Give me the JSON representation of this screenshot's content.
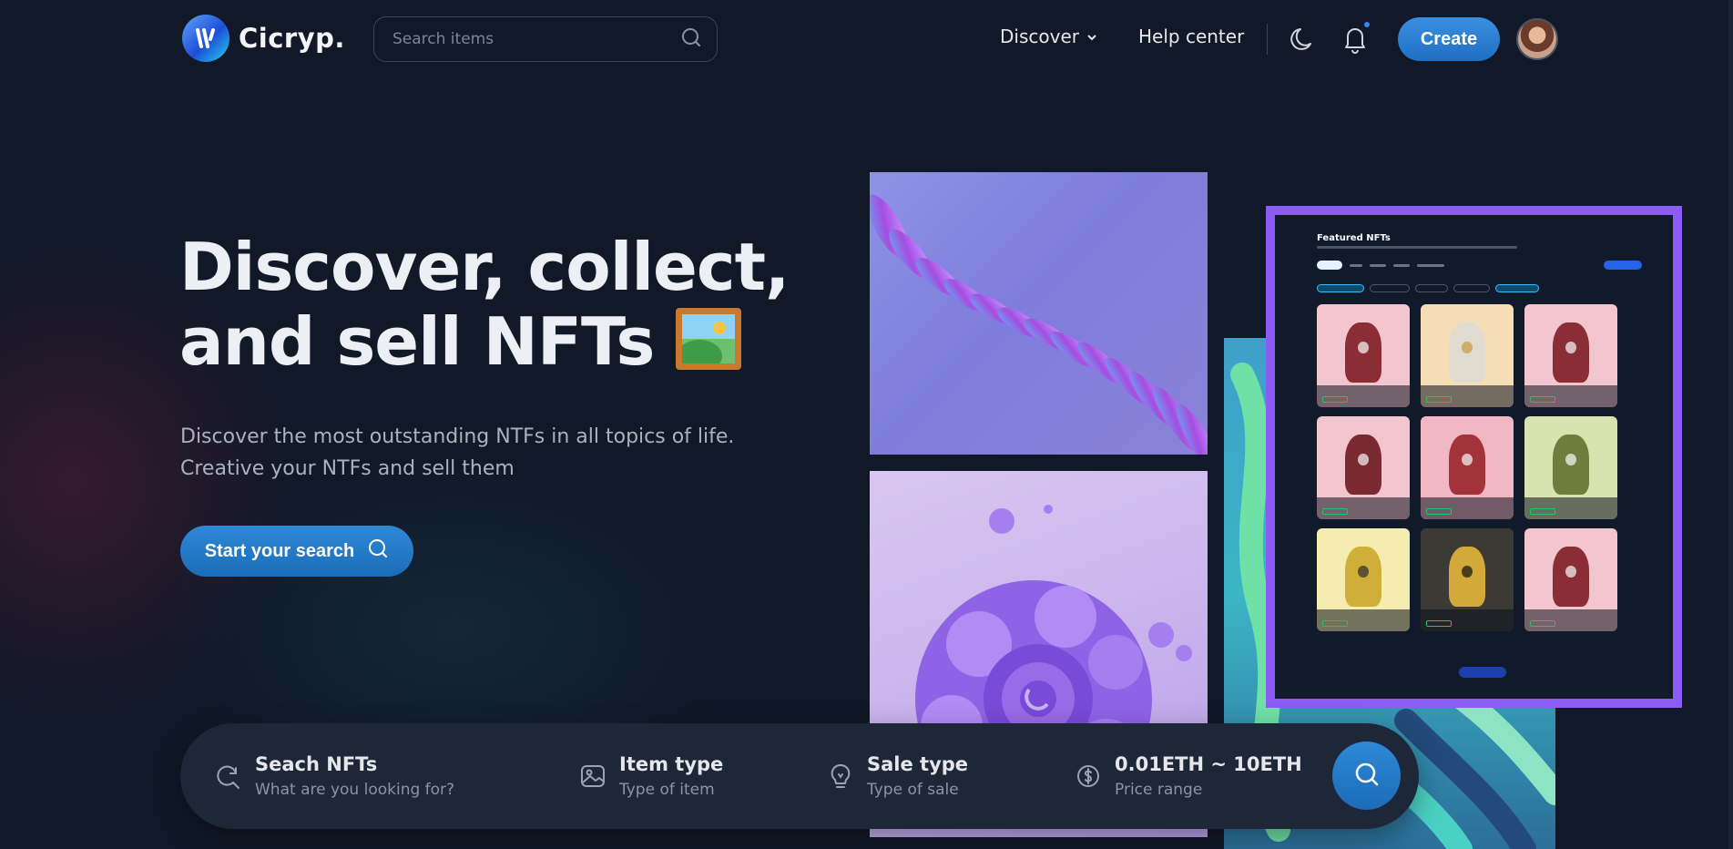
{
  "brand": {
    "name": "Cicryp."
  },
  "header": {
    "search_placeholder": "Search items",
    "nav_discover": "Discover",
    "nav_help": "Help center",
    "create_label": "Create"
  },
  "hero": {
    "title_line1": "Discover, collect,",
    "title_line2": "and sell NFTs",
    "subtitle_line1": "Discover the most outstanding NTFs in all topics of life.",
    "subtitle_line2": "Creative your NTFs and sell them",
    "cta_label": "Start your search"
  },
  "preview": {
    "title": "Featured NFTs"
  },
  "filter_bar": {
    "search": {
      "title": "Seach NFTs",
      "sub": "What are you looking for?"
    },
    "item_type": {
      "title": "Item type",
      "sub": "Type of item"
    },
    "sale_type": {
      "title": "Sale type",
      "sub": "Type of sale"
    },
    "price": {
      "title": "0.01ETH ~ 10ETH",
      "sub": "Price range"
    }
  },
  "colors": {
    "background": "#111827",
    "accent": "#2e89d6",
    "frame": "#8b5cf6"
  },
  "icons": [
    "logo-icon",
    "search-icon",
    "chevron-down-icon",
    "moon-icon",
    "bell-icon",
    "refresh-search-icon",
    "image-icon",
    "bulb-icon",
    "dollar-icon"
  ]
}
